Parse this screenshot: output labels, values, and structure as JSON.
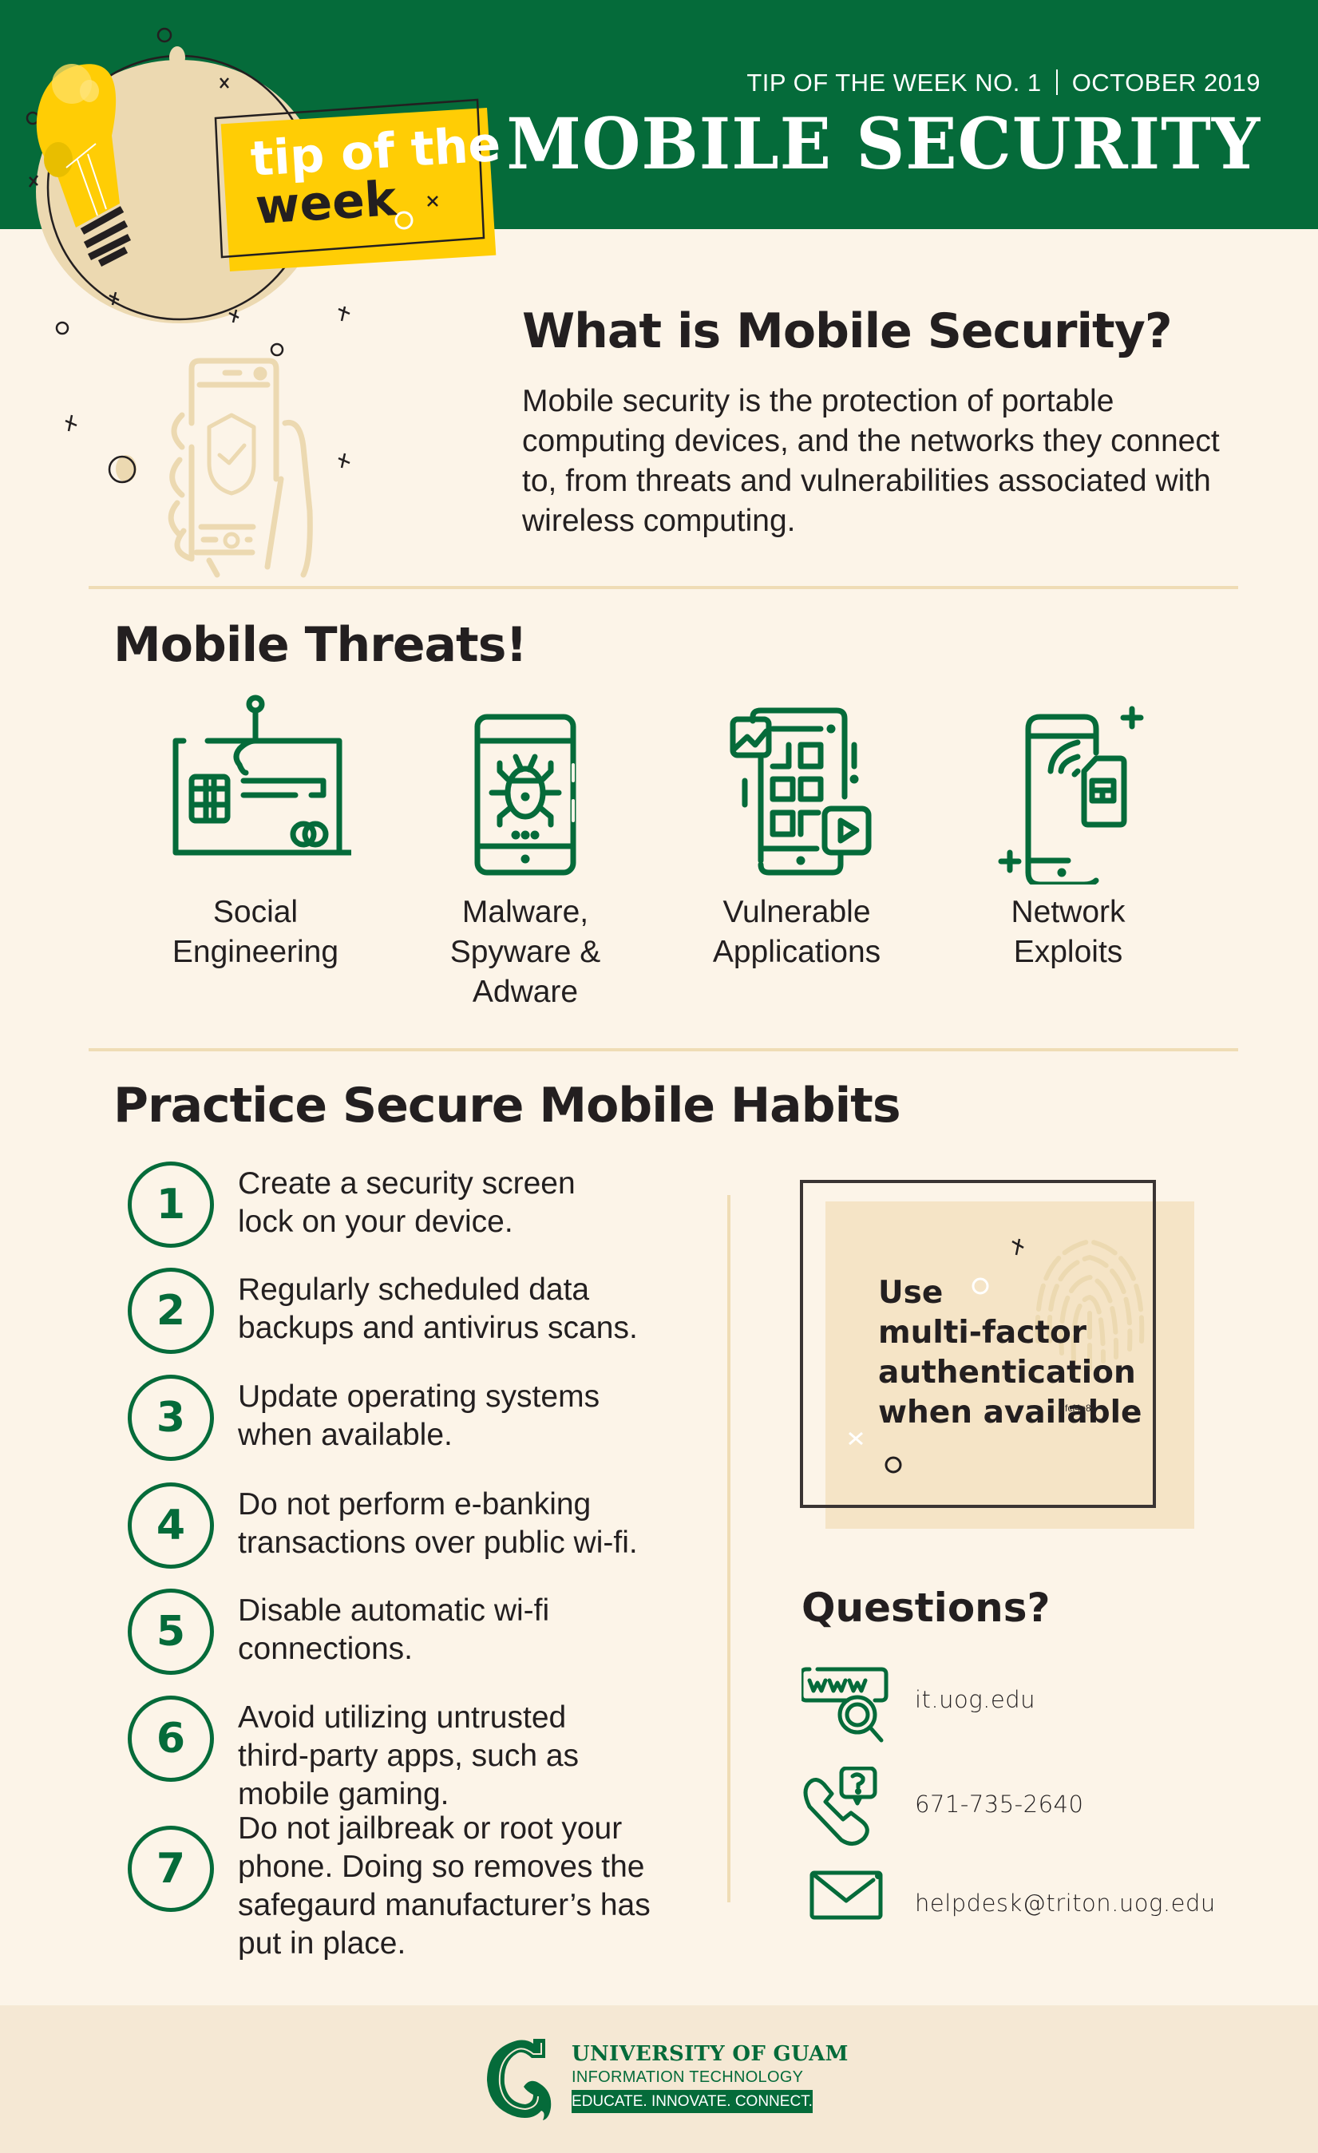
{
  "header": {
    "series_label": "TIP OF THE WEEK  NO. 1",
    "date_label": "OCTOBER 2019",
    "title": "MOBILE SECURITY"
  },
  "badge": {
    "line1": "tip of the",
    "line2": "week"
  },
  "what_is": {
    "title": "What is Mobile Security?",
    "body": "Mobile security is the protection of portable computing devices, and the networks they connect to, from threats and vulnerabilities associated with wireless computing."
  },
  "threats": {
    "title": "Mobile Threats!",
    "items": [
      {
        "icon": "phishing-card-icon",
        "label_lines": [
          "Social",
          "Engineering"
        ]
      },
      {
        "icon": "malware-phone-icon",
        "label_lines": [
          "Malware,",
          "Spyware &",
          "Adware"
        ]
      },
      {
        "icon": "vulnerable-apps-icon",
        "label_lines": [
          "Vulnerable",
          "Applications"
        ]
      },
      {
        "icon": "network-sim-phone-icon",
        "label_lines": [
          "Network",
          "Exploits"
        ]
      }
    ]
  },
  "practice": {
    "title": "Practice Secure Mobile Habits",
    "habits": [
      {
        "number": "1",
        "text": "Create a security screen lock on your device."
      },
      {
        "number": "2",
        "text": "Regularly scheduled data backups and antivirus scans."
      },
      {
        "number": "3",
        "text": "Update operating systems when available."
      },
      {
        "number": "4",
        "text": "Do not perform e-banking transactions over public wi-fi."
      },
      {
        "number": "5",
        "text": "Disable automatic wi-fi connections."
      },
      {
        "number": "6",
        "text": "Avoid utilizing untrusted third-party apps, such as mobile gaming."
      },
      {
        "number": "7",
        "text": "Do not jailbreak or root your phone. Doing so removes the safegaurd manufacturer’s has put in place."
      }
    ]
  },
  "mfa_card": {
    "lines": [
      "Use",
      "multi-factor",
      "authentication",
      "when available"
    ],
    "artifact_text": "fcf4e8",
    "icon": "fingerprint-icon"
  },
  "questions": {
    "title": "Questions?",
    "contacts": [
      {
        "icon": "www-search-icon",
        "value": "it.uog.edu"
      },
      {
        "icon": "phone-question-icon",
        "value": "671-735-2640"
      },
      {
        "icon": "envelope-icon",
        "value": "helpdesk@triton.uog.edu"
      }
    ]
  },
  "footer": {
    "org_name": "UNIVERSITY OF GUAM",
    "dept_name": "INFORMATION TECHNOLOGY",
    "tagline": "EDUCATE. INNOVATE. CONNECT."
  },
  "colors": {
    "brand_green": "#056b3a",
    "accent_yellow": "#ffcd05",
    "background": "#fcf4e8",
    "beige": "#efdcb5",
    "text": "#231f20"
  }
}
